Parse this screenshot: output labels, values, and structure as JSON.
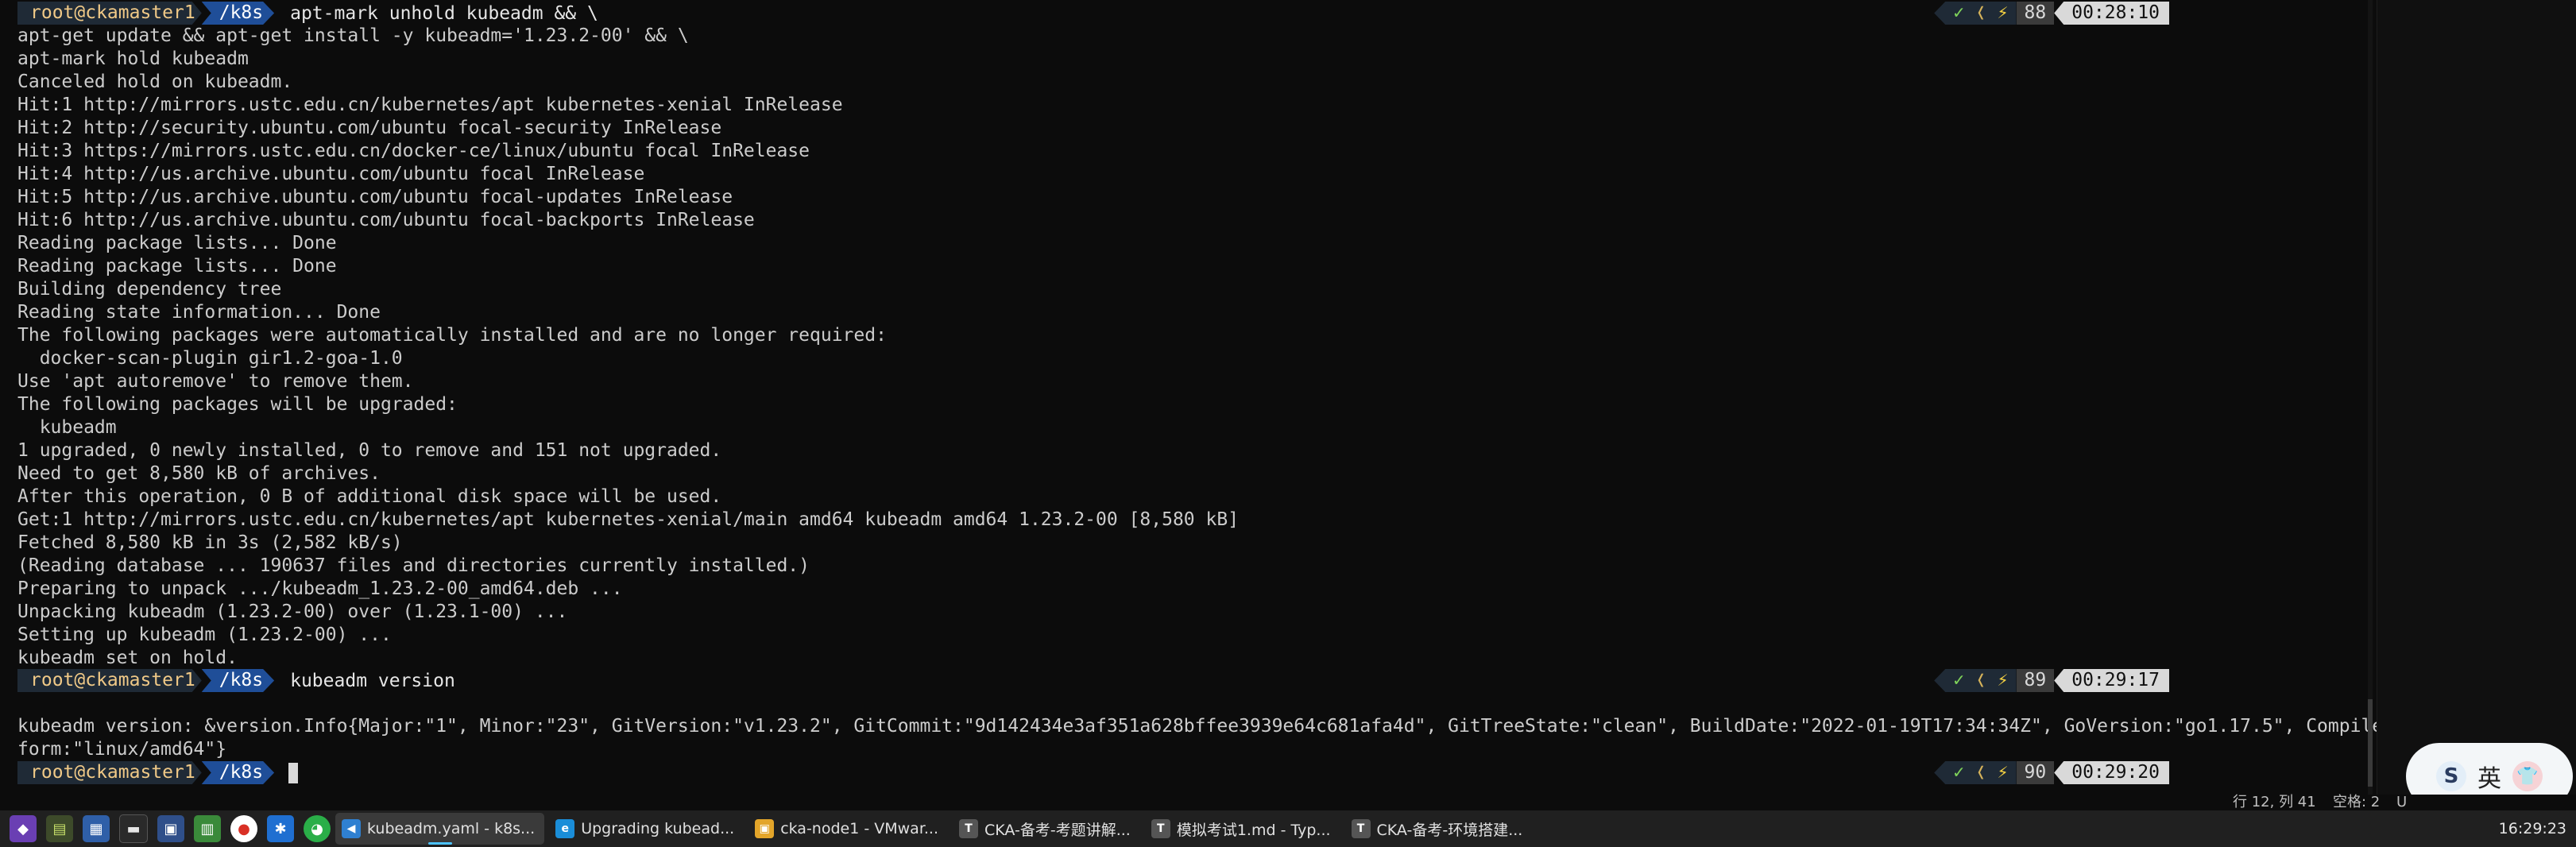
{
  "terminal": {
    "prompt": {
      "user_host": "root@ckamaster1",
      "dir": "/k8s"
    },
    "prompt1": {
      "command": "apt-mark unhold kubeadm && \\",
      "count": "88",
      "time": "00:28:10"
    },
    "lines_a": [
      "apt-get update && apt-get install -y kubeadm='1.23.2-00' && \\",
      "apt-mark hold kubeadm",
      "Canceled hold on kubeadm.",
      "Hit:1 http://mirrors.ustc.edu.cn/kubernetes/apt kubernetes-xenial InRelease",
      "Hit:2 http://security.ubuntu.com/ubuntu focal-security InRelease",
      "Hit:3 https://mirrors.ustc.edu.cn/docker-ce/linux/ubuntu focal InRelease",
      "Hit:4 http://us.archive.ubuntu.com/ubuntu focal InRelease",
      "Hit:5 http://us.archive.ubuntu.com/ubuntu focal-updates InRelease",
      "Hit:6 http://us.archive.ubuntu.com/ubuntu focal-backports InRelease",
      "Reading package lists... Done",
      "Reading package lists... Done",
      "Building dependency tree",
      "Reading state information... Done",
      "The following packages were automatically installed and are no longer required:",
      "  docker-scan-plugin gir1.2-goa-1.0",
      "Use 'apt autoremove' to remove them.",
      "The following packages will be upgraded:",
      "  kubeadm",
      "1 upgraded, 0 newly installed, 0 to remove and 151 not upgraded.",
      "Need to get 8,580 kB of archives.",
      "After this operation, 0 B of additional disk space will be used.",
      "Get:1 http://mirrors.ustc.edu.cn/kubernetes/apt kubernetes-xenial/main amd64 kubeadm amd64 1.23.2-00 [8,580 kB]",
      "Fetched 8,580 kB in 3s (2,582 kB/s)",
      "(Reading database ... 190637 files and directories currently installed.)",
      "Preparing to unpack .../kubeadm_1.23.2-00_amd64.deb ...",
      "Unpacking kubeadm (1.23.2-00) over (1.23.1-00) ...",
      "Setting up kubeadm (1.23.2-00) ...",
      "kubeadm set on hold."
    ],
    "prompt2": {
      "command": "kubeadm version",
      "count": "89",
      "time": "00:29:17"
    },
    "lines_b": [
      "kubeadm version: &version.Info{Major:\"1\", Minor:\"23\", GitVersion:\"v1.23.2\", GitCommit:\"9d142434e3af351a628bffee3939e64c681afa4d\", GitTreeState:\"clean\", BuildDate:\"2022-01-19T17:34:34Z\", GoVersion:\"go1.17.5\", Compiler:\"gc\", Plat",
      "form:\"linux/amd64\"}"
    ],
    "prompt3": {
      "command": "",
      "count": "90",
      "time": "00:29:20"
    },
    "status_glyphs": {
      "check": "✓",
      "chevron": "❬",
      "bolt": "⚡"
    }
  },
  "ime": {
    "logo": "S",
    "lang": "英",
    "skin": "👕"
  },
  "editor_status": {
    "position": "行 12, 列 41",
    "spaces": "空格: 2",
    "encoding": "U"
  },
  "taskbar": {
    "apps": [
      {
        "label": "kubeadm.yaml - k8s...",
        "icon": "vscode-icon",
        "glyph": "◀",
        "color": "#2f80d1",
        "active": true
      },
      {
        "label": "Upgrading kubead...",
        "icon": "edge-icon",
        "glyph": "e",
        "color": "#1a8dd8",
        "active": false
      },
      {
        "label": "cka-node1 - VMwar...",
        "icon": "vmware-icon",
        "glyph": "▣",
        "color": "#e3a52a",
        "active": false
      },
      {
        "label": "CKA-备考-考题讲解...",
        "icon": "typora-icon",
        "glyph": "T",
        "color": "#555555",
        "active": false
      },
      {
        "label": "模拟考试1.md - Typ...",
        "icon": "typora-icon",
        "glyph": "T",
        "color": "#555555",
        "active": false
      },
      {
        "label": "CKA-备考-环境搭建...",
        "icon": "typora-icon",
        "glyph": "T",
        "color": "#555555",
        "active": false
      }
    ],
    "clock": "16:29:23"
  }
}
